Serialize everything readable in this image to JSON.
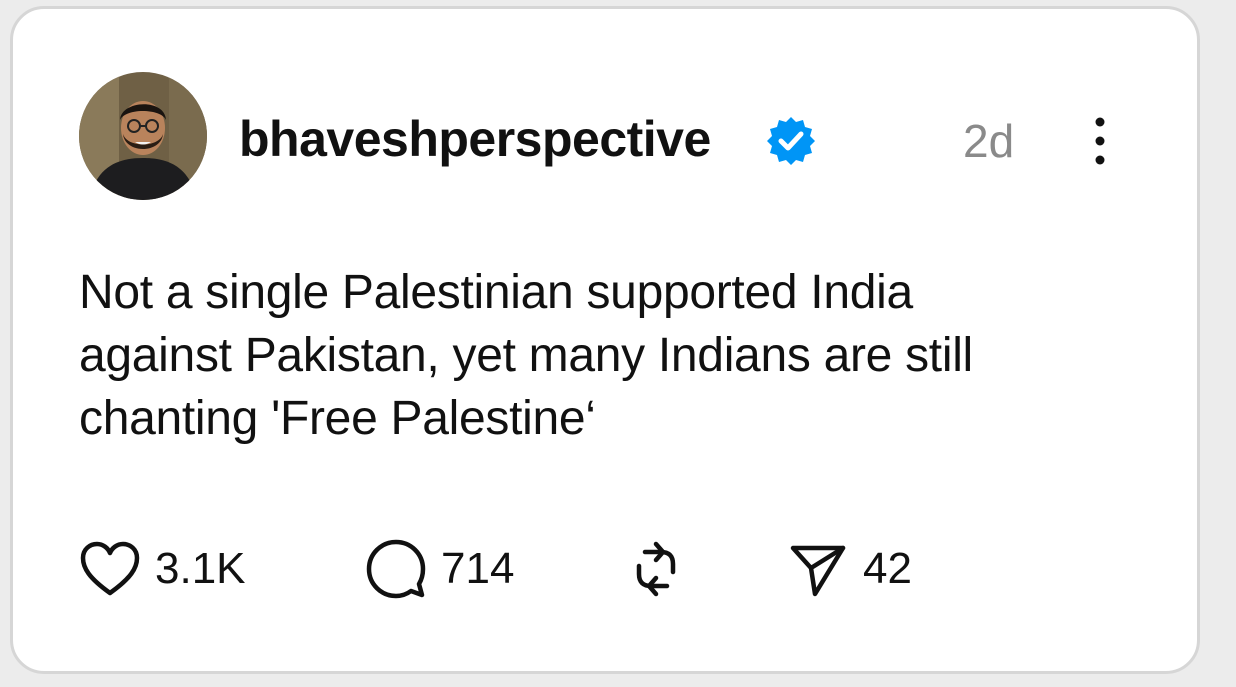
{
  "post": {
    "username": "bhaveshperspective",
    "verified": true,
    "time": "2d",
    "text": "Not a single Palestinian supported India\nagainst Pakistan, yet many Indians are still\nchanting 'Free Palestine‘",
    "stats": {
      "likes": "3.1K",
      "comments": "714",
      "shares": "42"
    }
  },
  "icons": {
    "more": "more-vertical-icon",
    "like": "heart-icon",
    "comment": "comment-icon",
    "repost": "repost-icon",
    "share": "send-icon",
    "verified": "verified-badge-icon"
  },
  "colors": {
    "verified_blue": "#0095f6",
    "time_gray": "#8a8a8a",
    "text": "#111111"
  }
}
